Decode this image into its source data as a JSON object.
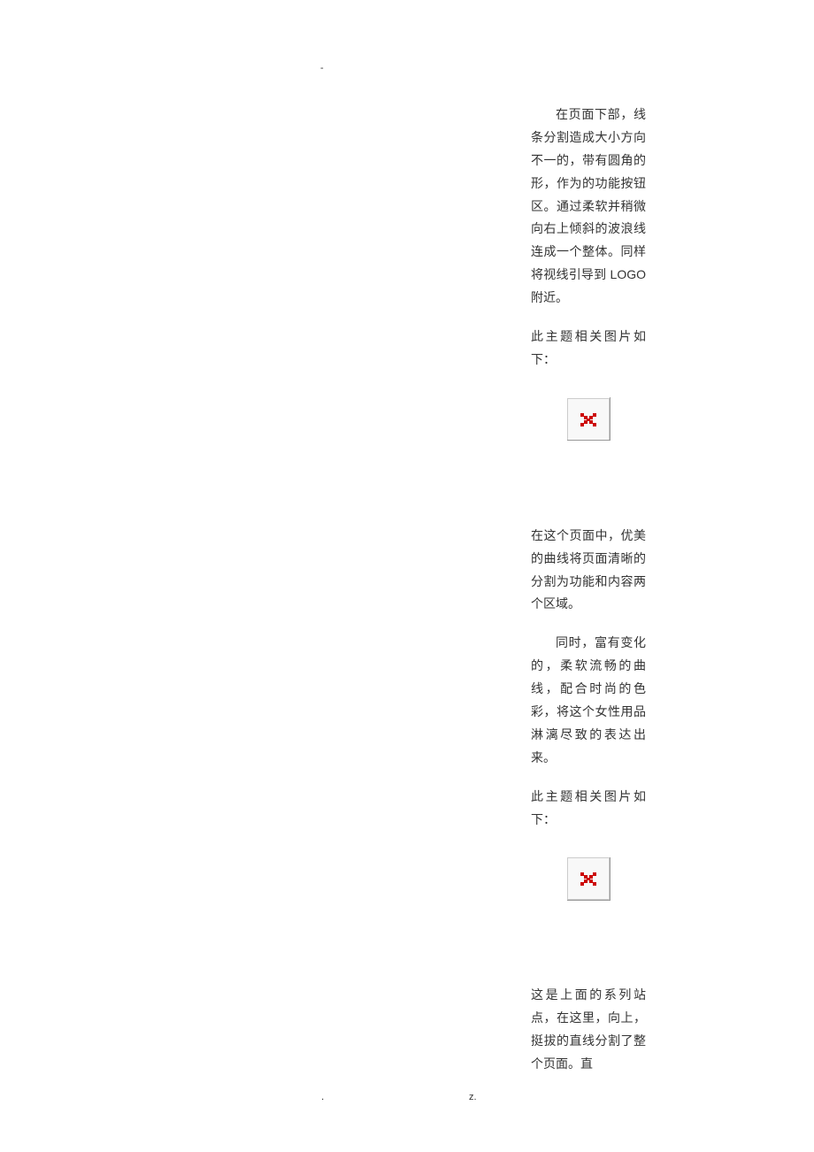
{
  "header_mark": "-",
  "paragraphs": {
    "p1": "在页面下部，线条分割造成大小方向不一的，带有圆角的形，作为的功能按钮区。通过柔软并稍微向右上倾斜的波浪线连成一个整体。同样将视线引导到 LOGO 附近。",
    "p2": "此主题相关图片如下：",
    "p3": "在这个页面中，优美的曲线将页面清晰的分割为功能和内容两个区域。",
    "p4": "同时，富有变化的，柔软流畅的曲线，配合时尚的色彩，将这个女性用品淋漓尽致的表达出来。",
    "p5": "此主题相关图片如下：",
    "p6": "这是上面的系列站点，在这里，向上，挺拔的直线分割了整个页面。直"
  },
  "footer": {
    "dot": ".",
    "z": "z."
  }
}
